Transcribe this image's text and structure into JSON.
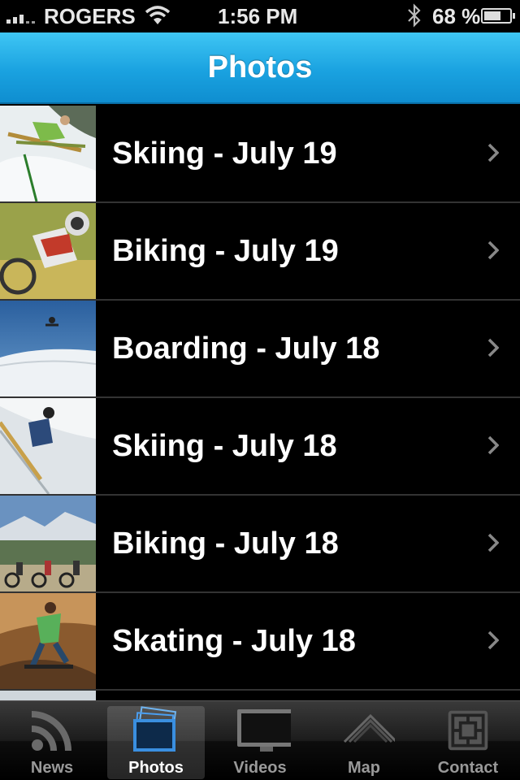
{
  "status_bar": {
    "carrier": "ROGERS",
    "time": "1:56 PM",
    "battery_percent": "68 %",
    "battery_level": 0.68
  },
  "nav": {
    "title": "Photos"
  },
  "rows": [
    {
      "label": "Skiing - July 19",
      "thumb": "skiing-photo"
    },
    {
      "label": "Biking - July 19",
      "thumb": "biking-photo"
    },
    {
      "label": "Boarding - July 18",
      "thumb": "boarding-photo"
    },
    {
      "label": "Skiing - July 18",
      "thumb": "skiing-photo"
    },
    {
      "label": "Biking - July 18",
      "thumb": "biking-photo"
    },
    {
      "label": "Skating - July 18",
      "thumb": "skating-photo"
    }
  ],
  "tabs": [
    {
      "label": "News",
      "icon": "rss-icon"
    },
    {
      "label": "Photos",
      "icon": "photos-icon",
      "active": true
    },
    {
      "label": "Videos",
      "icon": "monitor-icon"
    },
    {
      "label": "Map",
      "icon": "mountain-icon"
    },
    {
      "label": "Contact",
      "icon": "contact-icon"
    }
  ],
  "colors": {
    "nav_blue": "#1aa2e0",
    "active_tab_blue": "#3a8fe0"
  }
}
